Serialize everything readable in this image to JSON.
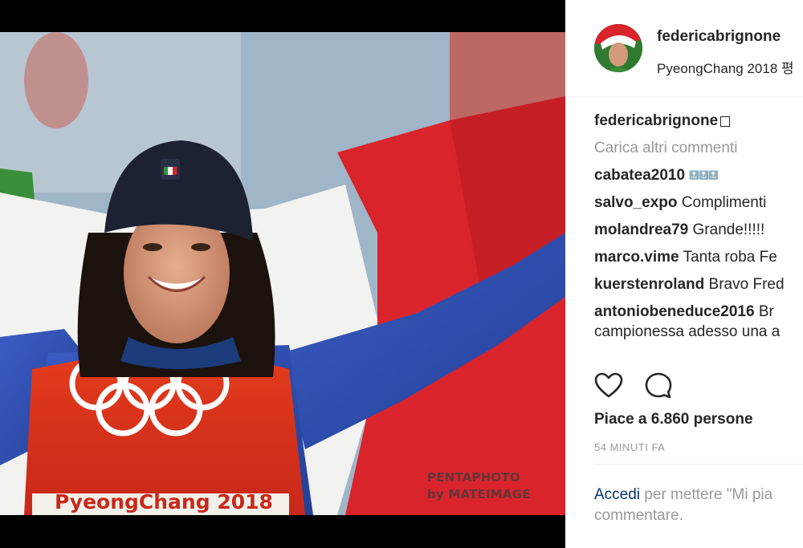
{
  "post": {
    "username": "federicabrignone",
    "location": "PyeongChang 2018 평",
    "watermark_line1": "PENTAPHOTO",
    "watermark_line2": "by MATEIMAGE",
    "bib_text": "PyeongChang 2018"
  },
  "caption": {
    "username": "federicabrignone"
  },
  "load_more": "Carica altri commenti",
  "comments": [
    {
      "user": "cabatea2010",
      "text": "🔝🔝🔝"
    },
    {
      "user": "salvo_expo",
      "text": "Complimenti"
    },
    {
      "user": "molandrea79",
      "text": "Grande!!!!!"
    },
    {
      "user": "marco.vime",
      "text": "Tanta roba Fe"
    },
    {
      "user": "kuerstenroland",
      "text": "Bravo Fred"
    },
    {
      "user": "antoniobeneduce2016",
      "text": "Br",
      "text_line2": "campionessa adesso una a"
    }
  ],
  "actions": {
    "like_icon": "heart-icon",
    "comment_icon": "speech-bubble-icon"
  },
  "likes_text": "Piace a 6.860 persone",
  "time_ago": "54 MINUTI FA",
  "login": {
    "link": "Accedi",
    "rest": " per mettere \"Mi pia",
    "line2": "commentare."
  },
  "colors": {
    "link_blue": "#003569",
    "muted_gray": "#999999",
    "text_dark": "#262626",
    "flag_red": "#d9242b",
    "flag_green": "#3a8f3a",
    "suit_blue": "#2f4fb0"
  }
}
